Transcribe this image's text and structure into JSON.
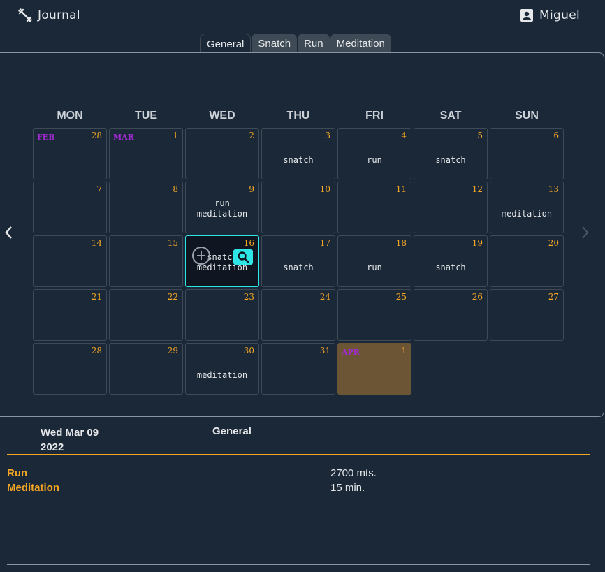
{
  "header": {
    "app_title": "Journal",
    "user_name": "Miguel"
  },
  "tabs": [
    {
      "label": "General",
      "active": true
    },
    {
      "label": "Snatch",
      "active": false
    },
    {
      "label": "Run",
      "active": false
    },
    {
      "label": "Meditation",
      "active": false
    }
  ],
  "calendar": {
    "weekdays": [
      "MON",
      "TUE",
      "WED",
      "THU",
      "FRI",
      "SAT",
      "SUN"
    ],
    "weeks": [
      [
        {
          "day": "28",
          "month": "FEB",
          "activities": []
        },
        {
          "day": "1",
          "month": "MAR",
          "activities": []
        },
        {
          "day": "2",
          "activities": []
        },
        {
          "day": "3",
          "activities": [
            "snatch"
          ]
        },
        {
          "day": "4",
          "activities": [
            "run"
          ]
        },
        {
          "day": "5",
          "activities": [
            "snatch"
          ]
        },
        {
          "day": "6",
          "activities": []
        }
      ],
      [
        {
          "day": "7",
          "activities": []
        },
        {
          "day": "8",
          "activities": []
        },
        {
          "day": "9",
          "activities": [
            "run",
            "meditation"
          ]
        },
        {
          "day": "10",
          "activities": []
        },
        {
          "day": "11",
          "activities": []
        },
        {
          "day": "12",
          "activities": []
        },
        {
          "day": "13",
          "activities": [
            "meditation"
          ]
        }
      ],
      [
        {
          "day": "14",
          "activities": []
        },
        {
          "day": "15",
          "activities": []
        },
        {
          "day": "16",
          "activities": [
            "snatch",
            "meditation"
          ],
          "today": true
        },
        {
          "day": "17",
          "activities": [
            "snatch"
          ]
        },
        {
          "day": "18",
          "activities": [
            "run"
          ]
        },
        {
          "day": "19",
          "activities": [
            "snatch"
          ]
        },
        {
          "day": "20",
          "activities": []
        }
      ],
      [
        {
          "day": "21",
          "activities": []
        },
        {
          "day": "22",
          "activities": []
        },
        {
          "day": "23",
          "activities": []
        },
        {
          "day": "24",
          "activities": []
        },
        {
          "day": "25",
          "activities": []
        },
        {
          "day": "26",
          "activities": []
        },
        {
          "day": "27",
          "activities": []
        }
      ],
      [
        {
          "day": "28",
          "activities": []
        },
        {
          "day": "29",
          "activities": []
        },
        {
          "day": "30",
          "activities": [
            "meditation"
          ]
        },
        {
          "day": "31",
          "activities": []
        },
        {
          "day": "1",
          "month": "APR",
          "activities": [],
          "next_month": true
        }
      ]
    ]
  },
  "details": {
    "date": "Wed Mar 09 2022",
    "category": "General",
    "entries": [
      {
        "label": "Run",
        "value": "2700 mts."
      },
      {
        "label": "Meditation",
        "value": "15 min."
      }
    ]
  },
  "colors": {
    "background": "#1b2838",
    "accent": "#f5a623",
    "month_label": "#a52ad6",
    "today_border": "#2ee6e6",
    "next_month_cell": "#6b5535"
  },
  "icons": {
    "brand": "dumbbell-icon",
    "user": "account-box-icon",
    "prev": "chevron-left-icon",
    "next": "chevron-right-icon",
    "add": "add-circle-icon",
    "search": "search-icon"
  }
}
